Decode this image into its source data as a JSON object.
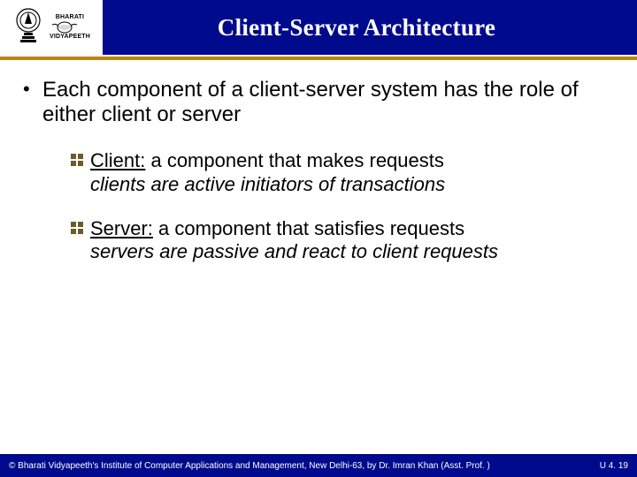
{
  "header": {
    "title": "Client-Server Architecture",
    "logo_lines": [
      "BHARATI",
      "VIDYAPEETH"
    ]
  },
  "content": {
    "main_bullet": "Each component of a client-server system has the role of either client or server",
    "items": [
      {
        "term": "Client:",
        "desc": " a component that makes requests",
        "italic": "clients are active initiators of transactions"
      },
      {
        "term": "Server:",
        "desc": " a component that satisfies requests",
        "italic": "servers are passive and react to client requests"
      }
    ]
  },
  "footer": {
    "copyright": "© Bharati Vidyapeeth's Institute of Computer Applications and Management, New Delhi-63,  by  Dr. Imran Khan (Asst. Prof. )",
    "pagenum": "U 4. 19"
  }
}
